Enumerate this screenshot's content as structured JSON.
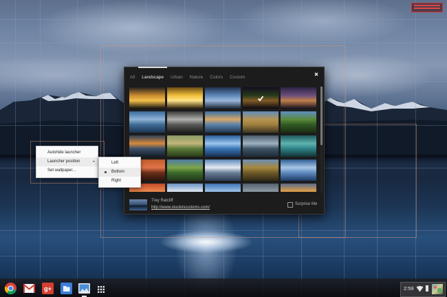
{
  "picker": {
    "tabs": [
      {
        "label": "All",
        "active": false
      },
      {
        "label": "Landscape",
        "active": true
      },
      {
        "label": "Urban",
        "active": false
      },
      {
        "label": "Nature",
        "active": false
      },
      {
        "label": "Colors",
        "active": false
      },
      {
        "label": "Custom",
        "active": false
      }
    ],
    "close_icon": "close-icon",
    "selected_thumbnail": 3,
    "selected_icon": "check-icon",
    "thumbnails": [
      {
        "subject": "sunset-shore",
        "colors": [
          "#25211e",
          "#c98a2e",
          "#f3c14a",
          "#12100e"
        ]
      },
      {
        "subject": "golden-sunrise",
        "colors": [
          "#6a4a14",
          "#f0be3a",
          "#ffe38a",
          "#2a1c08"
        ]
      },
      {
        "subject": "blue-mountains-selected",
        "colors": [
          "#1e3350",
          "#5e86b8",
          "#9bb8dc",
          "#1a2436"
        ]
      },
      {
        "subject": "aurora-night",
        "colors": [
          "#1b1630",
          "#3d5a2c",
          "#c88d3a",
          "#100d1c"
        ]
      },
      {
        "subject": "purple-dusk",
        "colors": [
          "#2c2446",
          "#6a4e7a",
          "#c07f4a",
          "#151020"
        ]
      },
      {
        "subject": "lake-reflection",
        "colors": [
          "#3c6a9c",
          "#8fb4d6",
          "#3e6c96",
          "#1c3452"
        ]
      },
      {
        "subject": "misty-shore",
        "colors": [
          "#3a3a3a",
          "#b0b0ae",
          "#5a5a58",
          "#1c1c1c"
        ]
      },
      {
        "subject": "bay-sunset",
        "colors": [
          "#3a6fa8",
          "#d8a868",
          "#5a84ad",
          "#22344c"
        ]
      },
      {
        "subject": "golden-field",
        "colors": [
          "#5f8bbd",
          "#b69552",
          "#9f7f3e",
          "#3e3622"
        ]
      },
      {
        "subject": "green-valley",
        "colors": [
          "#5d8fc0",
          "#5a8a3a",
          "#2f5a22",
          "#1c2c14"
        ]
      },
      {
        "subject": "coastal-sunset",
        "colors": [
          "#2e4058",
          "#d58a3c",
          "#3c5068",
          "#141c26"
        ]
      },
      {
        "subject": "country-road",
        "colors": [
          "#8a9a64",
          "#c2b57a",
          "#5a7a38",
          "#2a3a18"
        ]
      },
      {
        "subject": "blue-streaks",
        "colors": [
          "#2a5e9c",
          "#9cc6ee",
          "#3a74b4",
          "#163052"
        ]
      },
      {
        "subject": "misty-lake",
        "colors": [
          "#4a5a6a",
          "#9eb2c2",
          "#3e5466",
          "#1e2a34"
        ]
      },
      {
        "subject": "teal-glacier",
        "colors": [
          "#1e5a5c",
          "#5eb2b0",
          "#2e8286",
          "#123436"
        ]
      },
      {
        "subject": "waterfall-red",
        "colors": [
          "#c05c2a",
          "#e2744a",
          "#6a2e1a",
          "#2a140c"
        ]
      },
      {
        "subject": "lake-meadow",
        "colors": [
          "#4a7aa4",
          "#7ea54a",
          "#3a6a2a",
          "#22361a"
        ]
      },
      {
        "subject": "snow-peaks",
        "colors": [
          "#5e88b8",
          "#e4eaf2",
          "#6a7e94",
          "#2a3c54"
        ]
      },
      {
        "subject": "rolling-hills",
        "colors": [
          "#6a8fb6",
          "#a6893e",
          "#6e5a2a",
          "#302814"
        ]
      },
      {
        "subject": "cloud-sky",
        "colors": [
          "#2e5c94",
          "#a8c6e6",
          "#5e8ac0",
          "#1c3a62"
        ]
      },
      {
        "subject": "red-lake-bottom",
        "colors": [
          "#c24a2a",
          "#ee8a4c",
          "#8a2a18",
          "#3a120a"
        ]
      },
      {
        "subject": "peaks-bottom",
        "colors": [
          "#6a92c2",
          "#dfe8f2",
          "#5a7ea4",
          "#2a4262"
        ]
      },
      {
        "subject": "blue-bottom",
        "colors": [
          "#3e72b2",
          "#9ec4ea",
          "#2a5a94",
          "#142e54"
        ]
      },
      {
        "subject": "dark-hills-bottom",
        "colors": [
          "#54606e",
          "#8e9aa4",
          "#2e3844",
          "#14181e"
        ]
      },
      {
        "subject": "sunset-lake-bottom",
        "colors": [
          "#5a6a8a",
          "#e2a046",
          "#8a5a2a",
          "#241608"
        ]
      }
    ],
    "author_name": "Trey Ratcliff",
    "author_link": "http://www.stuckincustoms.com/",
    "surprise_label": "Surprise Me",
    "surprise_checked": false,
    "scroll_fraction_visible": 0.55
  },
  "menu": {
    "items": [
      {
        "label": "Autohide launcher"
      },
      {
        "label": "Launcher position",
        "has_submenu": true,
        "highlighted": true
      },
      {
        "label": "Set wallpaper..."
      }
    ],
    "submenu_arrow": "▸"
  },
  "submenu": {
    "items": [
      {
        "label": "Left",
        "selected": false
      },
      {
        "label": "Bottom",
        "selected": true
      },
      {
        "label": "Right",
        "selected": false
      }
    ]
  },
  "shelf": {
    "apps": [
      {
        "name": "chrome-icon",
        "open": false
      },
      {
        "name": "gmail-icon",
        "open": false
      },
      {
        "name": "google-plus-icon",
        "open": false
      },
      {
        "name": "files-icon",
        "open": false
      },
      {
        "name": "wallpaper-picker-icon",
        "open": true
      }
    ],
    "app_list_icon": "app-list-icon",
    "clock": "2:59",
    "wifi_icon": "wifi-icon",
    "battery_icon": "battery-icon",
    "avatar_icon": "avatar"
  }
}
